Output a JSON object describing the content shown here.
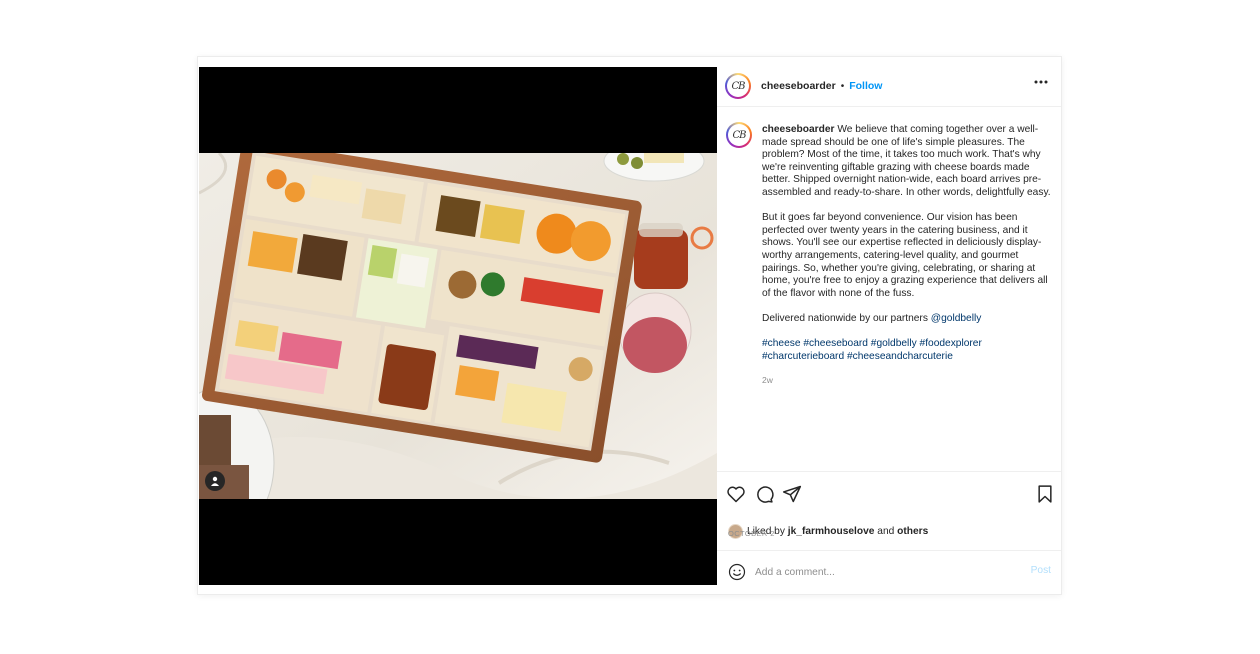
{
  "post": {
    "username": "cheeseboarder",
    "avatar_initials": "CB",
    "follow_label": "Follow",
    "separator": "•",
    "caption": {
      "paragraph1": "We believe that coming together over a well-made spread should be one of life's simple pleasures. The problem? Most of the time, it takes too much work. That's why we're reinventing giftable grazing with cheese boards made better. Shipped overnight nation-wide, each board arrives pre-assembled and ready-to-share. In other words, delightfully easy.",
      "paragraph2": "But it goes far beyond convenience. Our vision has been perfected over twenty years in the catering business, and it shows. You'll see our expertise reflected in deliciously display-worthy arrangements, catering-level quality, and gourmet pairings. So, whether you're giving, celebrating, or sharing at home, you're free to enjoy a grazing experience that delivers all of the flavor with none of the fuss.",
      "paragraph3_text": "Delivered nationwide by our partners",
      "paragraph3_mention": "@goldbelly",
      "hashtags": [
        "#cheese",
        "#cheeseboard",
        "#goldbelly",
        "#foodexplorer",
        "#charcuterieboard",
        "#cheeseandcharcuterie"
      ]
    },
    "time_ago": "2w",
    "likes": {
      "prefix": "Liked by",
      "user": "jk_farmhouselove",
      "joiner": "and",
      "others": "others"
    },
    "date": "OCTOBER 2",
    "comment": {
      "placeholder": "Add a comment...",
      "post_label": "Post"
    }
  },
  "icons": {
    "more": "more-horizontal-icon",
    "like": "heart-icon",
    "comment": "comment-icon",
    "share": "send-icon",
    "save": "bookmark-icon",
    "emoji": "emoji-icon",
    "tag": "user-tag-icon"
  },
  "colors": {
    "link_blue": "#0095f6",
    "mention": "#00376b",
    "muted": "#8e8e8e",
    "post_disabled": "#b2dffc"
  }
}
